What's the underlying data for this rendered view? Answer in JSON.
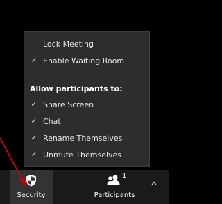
{
  "menu": {
    "items": [
      {
        "label": "Lock Meeting",
        "checked": false
      },
      {
        "label": "Enable Waiting Room",
        "checked": true
      }
    ],
    "section_header": "Allow participants to:",
    "permissions": [
      {
        "label": "Share Screen",
        "checked": true
      },
      {
        "label": "Chat",
        "checked": true
      },
      {
        "label": "Rename Themselves",
        "checked": true
      },
      {
        "label": "Unmute Themselves",
        "checked": true
      }
    ],
    "check_glyph": "✓"
  },
  "toolbar": {
    "security_label": "Security",
    "participants_label": "Participants",
    "participants_count": "1"
  },
  "colors": {
    "menu_bg": "#2d2d2d",
    "toolbar_bg": "#1a1a1a",
    "annotation_arrow": "#cc0000"
  },
  "icons": {
    "security": "shield-icon",
    "participants": "participants-icon",
    "caret": "chevron-up-icon",
    "check": "checkmark-icon"
  }
}
